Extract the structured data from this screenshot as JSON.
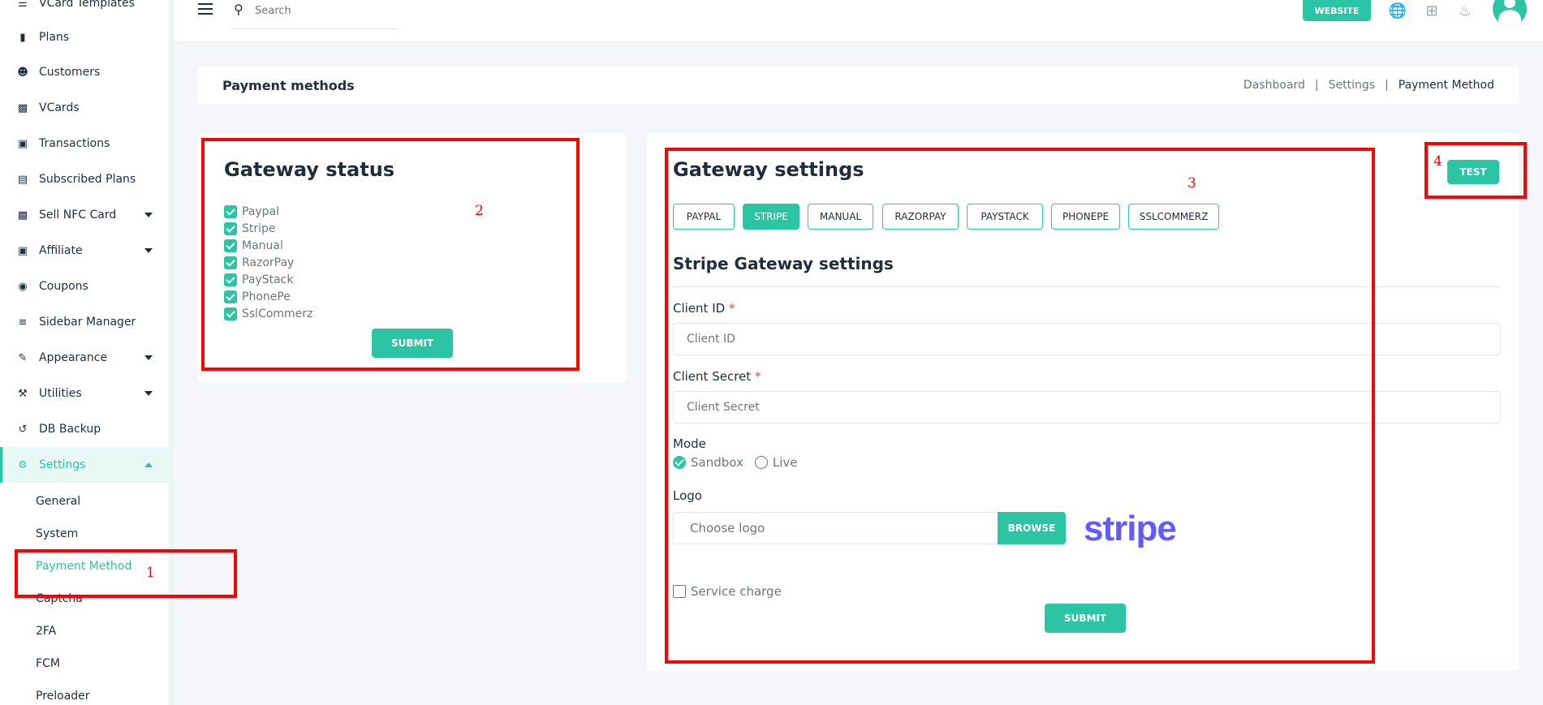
{
  "sidebar": {
    "items": [
      {
        "label": "VCard Templates",
        "icon": "layers-icon"
      },
      {
        "label": "Plans",
        "icon": "plan-icon"
      },
      {
        "label": "Customers",
        "icon": "users-icon"
      },
      {
        "label": "VCards",
        "icon": "vcard-icon"
      },
      {
        "label": "Transactions",
        "icon": "money-icon"
      },
      {
        "label": "Subscribed Plans",
        "icon": "archive-icon"
      },
      {
        "label": "Sell NFC Card",
        "icon": "card-icon"
      },
      {
        "label": "Affiliate",
        "icon": "cash-icon"
      },
      {
        "label": "Coupons",
        "icon": "money-bag-icon"
      },
      {
        "label": "Sidebar Manager",
        "icon": "list-icon"
      },
      {
        "label": "Appearance",
        "icon": "brush-icon"
      },
      {
        "label": "Utilities",
        "icon": "wrench-icon"
      },
      {
        "label": "DB Backup",
        "icon": "history-icon"
      },
      {
        "label": "Settings",
        "icon": "gears-icon"
      }
    ],
    "settings_sub": [
      "General",
      "System",
      "Payment Method",
      "Captcha",
      "2FA",
      "FCM",
      "Preloader"
    ],
    "active_item": "Settings",
    "active_sub": "Payment Method"
  },
  "topbar": {
    "search_placeholder": "Search",
    "website_label": "WEBSITE"
  },
  "header": {
    "title": "Payment methods",
    "breadcrumb": [
      "Dashboard",
      "|",
      "Settings",
      "|",
      "Payment Method"
    ]
  },
  "gateway_status": {
    "title": "Gateway status",
    "options": [
      "Paypal",
      "Stripe",
      "Manual",
      "RazorPay",
      "PayStack",
      "PhonePe",
      "SslCommerz"
    ],
    "submit_label": "SUBMIT"
  },
  "gateway_settings": {
    "title": "Gateway settings",
    "tabs": [
      "PAYPAL",
      "STRIPE",
      "MANUAL",
      "RAZORPAY",
      "PAYSTACK",
      "PHONEPE",
      "SSLCOMMERZ"
    ],
    "active_tab": "STRIPE",
    "test_label": "TEST",
    "section_title": "Stripe Gateway settings",
    "client_id_label": "Client ID",
    "client_id_placeholder": "Client ID",
    "client_secret_label": "Client Secret",
    "client_secret_placeholder": "Client Secret",
    "required_mark": "*",
    "mode_label": "Mode",
    "mode_options": [
      "Sandbox",
      "Live"
    ],
    "mode_selected": "Sandbox",
    "logo_label": "Logo",
    "logo_placeholder": "Choose logo",
    "browse_label": "BROWSE",
    "stripe_logo_text": "stripe",
    "service_charge_label": "Service charge",
    "submit_label": "SUBMIT"
  },
  "annotations": [
    "1",
    "2",
    "3",
    "4"
  ],
  "colors": {
    "accent": "#2cc5a3",
    "annotation": "#ff0000",
    "stripe": "#635bff"
  }
}
